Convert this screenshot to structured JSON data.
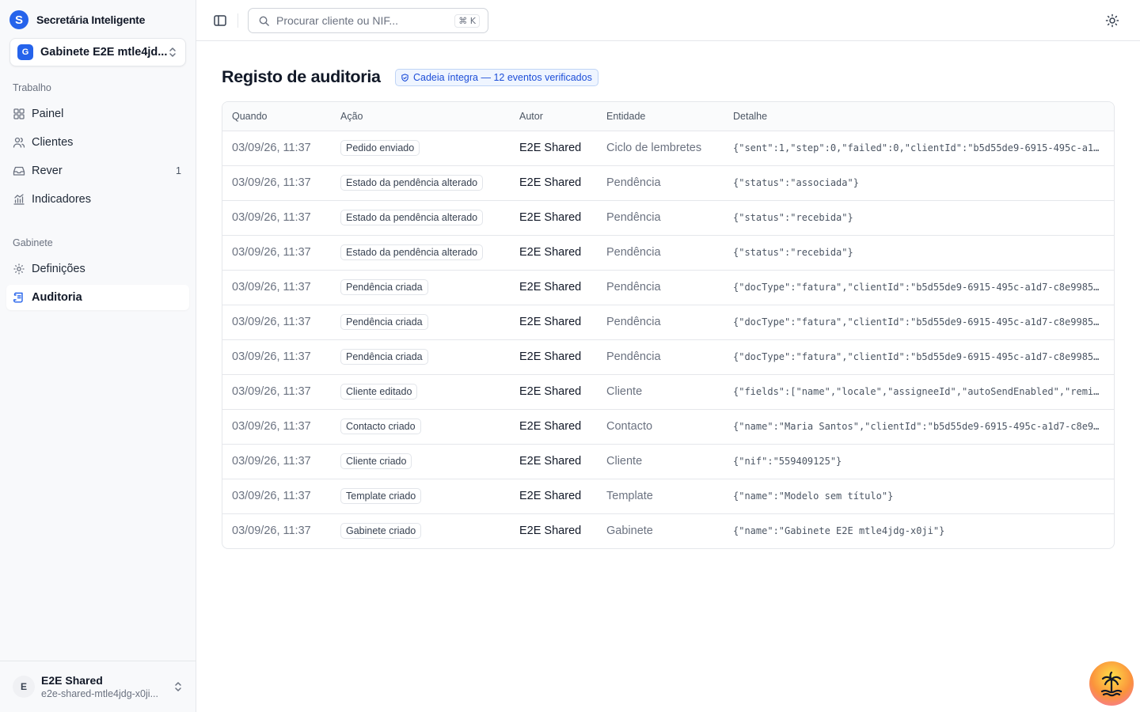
{
  "brand": {
    "name": "Secretária Inteligente",
    "logo_letter": "S"
  },
  "office_switcher": {
    "badge": "G",
    "name": "Gabinete E2E mtle4jd..."
  },
  "nav": {
    "work_section": "Trabalho",
    "work_items": [
      {
        "label": "Painel",
        "icon": "grid-icon",
        "count": ""
      },
      {
        "label": "Clientes",
        "icon": "users-icon",
        "count": ""
      },
      {
        "label": "Rever",
        "icon": "inbox-icon",
        "count": "1"
      },
      {
        "label": "Indicadores",
        "icon": "chart-icon",
        "count": ""
      }
    ],
    "office_section": "Gabinete",
    "office_items": [
      {
        "label": "Definições",
        "icon": "gear-icon",
        "active": false
      },
      {
        "label": "Auditoria",
        "icon": "scroll-icon",
        "active": true
      }
    ]
  },
  "user": {
    "avatar": "E",
    "name": "E2E Shared",
    "email": "e2e-shared-mtle4jdg-x0ji..."
  },
  "search": {
    "placeholder": "Procurar cliente ou NIF...",
    "shortcut": "⌘ K"
  },
  "page": {
    "title": "Registo de auditoria",
    "chain_status": "Cadeia íntegra — 12 eventos verificados",
    "accent_color": "#2563eb"
  },
  "table": {
    "columns": [
      "Quando",
      "Ação",
      "Autor",
      "Entidade",
      "Detalhe"
    ],
    "rows": [
      {
        "when": "03/09/26, 11:37",
        "action": "Pedido enviado",
        "author": "E2E Shared",
        "entity": "Ciclo de lembretes",
        "detail": "{\"sent\":1,\"step\":0,\"failed\":0,\"clientId\":\"b5d55de9-6915-495c-a1d…"
      },
      {
        "when": "03/09/26, 11:37",
        "action": "Estado da pendência alterado",
        "author": "E2E Shared",
        "entity": "Pendência",
        "detail": "{\"status\":\"associada\"}"
      },
      {
        "when": "03/09/26, 11:37",
        "action": "Estado da pendência alterado",
        "author": "E2E Shared",
        "entity": "Pendência",
        "detail": "{\"status\":\"recebida\"}"
      },
      {
        "when": "03/09/26, 11:37",
        "action": "Estado da pendência alterado",
        "author": "E2E Shared",
        "entity": "Pendência",
        "detail": "{\"status\":\"recebida\"}"
      },
      {
        "when": "03/09/26, 11:37",
        "action": "Pendência criada",
        "author": "E2E Shared",
        "entity": "Pendência",
        "detail": "{\"docType\":\"fatura\",\"clientId\":\"b5d55de9-6915-495c-a1d7-c8e99857…"
      },
      {
        "when": "03/09/26, 11:37",
        "action": "Pendência criada",
        "author": "E2E Shared",
        "entity": "Pendência",
        "detail": "{\"docType\":\"fatura\",\"clientId\":\"b5d55de9-6915-495c-a1d7-c8e99857…"
      },
      {
        "when": "03/09/26, 11:37",
        "action": "Pendência criada",
        "author": "E2E Shared",
        "entity": "Pendência",
        "detail": "{\"docType\":\"fatura\",\"clientId\":\"b5d55de9-6915-495c-a1d7-c8e99857…"
      },
      {
        "when": "03/09/26, 11:37",
        "action": "Cliente editado",
        "author": "E2E Shared",
        "entity": "Cliente",
        "detail": "{\"fields\":[\"name\",\"locale\",\"assigneeId\",\"autoSendEnabled\",\"remin…"
      },
      {
        "when": "03/09/26, 11:37",
        "action": "Contacto criado",
        "author": "E2E Shared",
        "entity": "Contacto",
        "detail": "{\"name\":\"Maria Santos\",\"clientId\":\"b5d55de9-6915-495c-a1d7-c8e99…"
      },
      {
        "when": "03/09/26, 11:37",
        "action": "Cliente criado",
        "author": "E2E Shared",
        "entity": "Cliente",
        "detail": "{\"nif\":\"559409125\"}"
      },
      {
        "when": "03/09/26, 11:37",
        "action": "Template criado",
        "author": "E2E Shared",
        "entity": "Template",
        "detail": "{\"name\":\"Modelo sem título\"}"
      },
      {
        "when": "03/09/26, 11:37",
        "action": "Gabinete criado",
        "author": "E2E Shared",
        "entity": "Gabinete",
        "detail": "{\"name\":\"Gabinete E2E mtle4jdg-x0ji\"}"
      }
    ]
  }
}
